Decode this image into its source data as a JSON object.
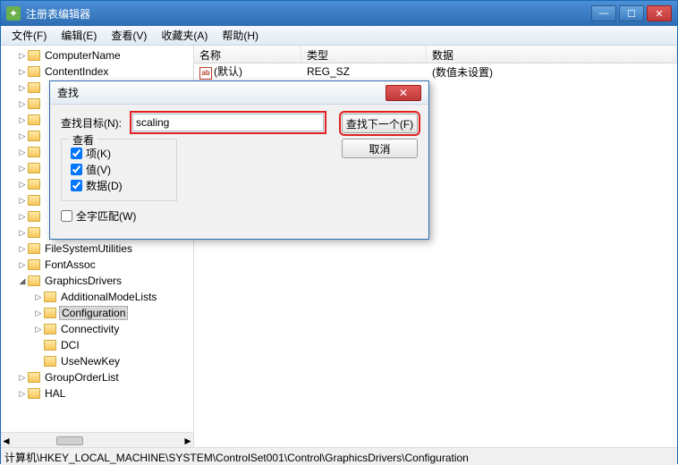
{
  "window": {
    "title": "注册表编辑器",
    "min": "—",
    "max": "☐",
    "close": "✕"
  },
  "menu": {
    "file": "文件(F)",
    "edit": "编辑(E)",
    "view": "查看(V)",
    "fav": "收藏夹(A)",
    "help": "帮助(H)"
  },
  "tree": {
    "nodes": [
      "ComputerName",
      "ContentIndex",
      "",
      "",
      "",
      "",
      "",
      "",
      "",
      "",
      "",
      "",
      "",
      "FileSystemUtilities",
      "FontAssoc",
      "GraphicsDrivers",
      "AdditionalModeLists",
      "Configuration",
      "Connectivity",
      "DCI",
      "UseNewKey",
      "GroupOrderList",
      "HAL"
    ],
    "selected": "Configuration"
  },
  "list": {
    "headers": {
      "name": "名称",
      "type": "类型",
      "data": "数据"
    },
    "row": {
      "name": "(默认)",
      "type": "REG_SZ",
      "data": "(数值未设置)"
    }
  },
  "dialog": {
    "title": "查找",
    "find_label": "查找目标(N):",
    "find_value": "scaling",
    "find_next": "查找下一个(F)",
    "cancel": "取消",
    "group_legend": "查看",
    "chk_keys": "项(K)",
    "chk_values": "值(V)",
    "chk_data": "数据(D)",
    "whole_word": "全字匹配(W)"
  },
  "status": {
    "path": "计算机\\HKEY_LOCAL_MACHINE\\SYSTEM\\ControlSet001\\Control\\GraphicsDrivers\\Configuration"
  }
}
